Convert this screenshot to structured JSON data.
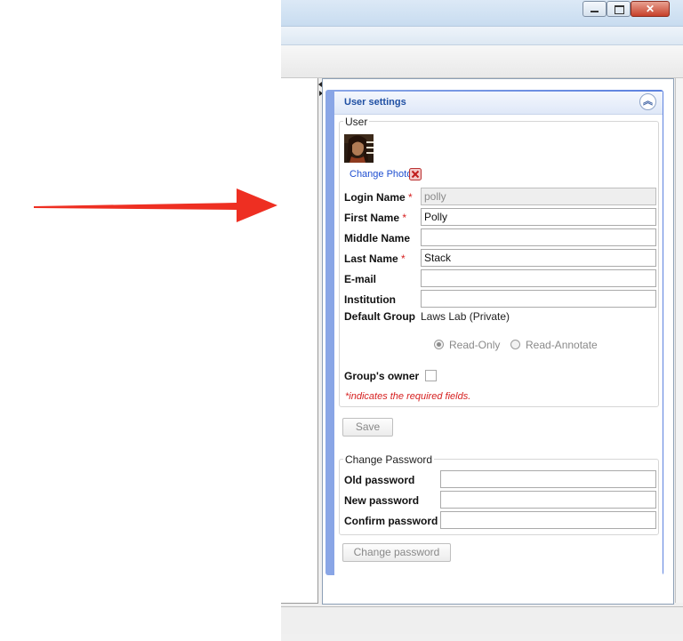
{
  "panel": {
    "title": "User settings"
  },
  "user_section": {
    "legend": "User",
    "change_photo": "Change Photo",
    "fields": {
      "login_name": {
        "label": "Login Name",
        "value": "polly"
      },
      "first_name": {
        "label": "First Name",
        "value": "Polly"
      },
      "middle_name": {
        "label": "Middle Name",
        "value": ""
      },
      "last_name": {
        "label": "Last Name",
        "value": "Stack"
      },
      "email": {
        "label": "E-mail",
        "value": ""
      },
      "institution": {
        "label": "Institution",
        "value": ""
      }
    },
    "required_marker": "*",
    "default_group": {
      "label": "Default Group",
      "value": "Laws Lab (Private)"
    },
    "permissions": {
      "read_only": "Read-Only",
      "read_annotate": "Read-Annotate",
      "selected": "Read-Only"
    },
    "group_owner": {
      "label": "Group's owner",
      "checked": false
    },
    "required_note_marker": "*",
    "required_note": "indicates the required fields."
  },
  "save_button": "Save",
  "password_section": {
    "legend": "Change Password",
    "old_password": "Old password",
    "new_password": "New password",
    "confirm_password": "Confirm password",
    "button": "Change password"
  },
  "colors": {
    "accent": "#5d82df",
    "required": "#d62020",
    "link": "#1f4fd1",
    "arrow": "#e8312a"
  }
}
